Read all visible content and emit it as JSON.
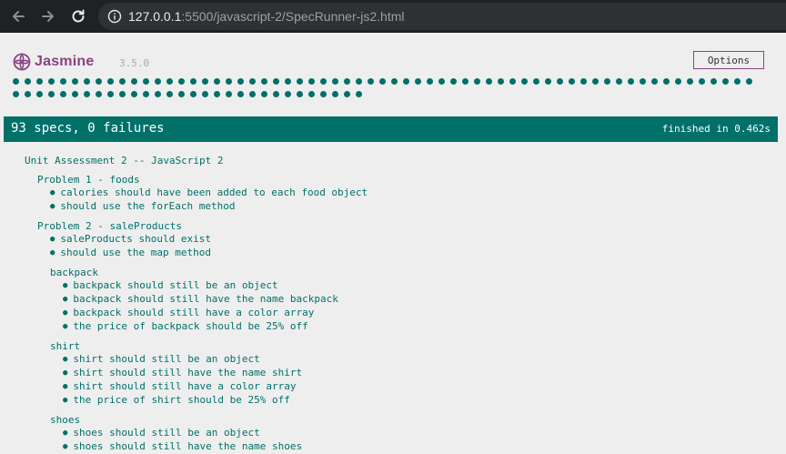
{
  "browser": {
    "url_host": "127.0.0.1",
    "url_rest": ":5500/javascript-2/SpecRunner-js2.html"
  },
  "header": {
    "logo": "Jasmine",
    "version": "3.5.0",
    "options_label": "Options"
  },
  "dots_count": 93,
  "summary": {
    "count_text": "93 specs, 0 failures",
    "finished_text": "finished in 0.462s"
  },
  "suite": {
    "title": "Unit Assessment 2 -- JavaScript 2",
    "children": [
      {
        "title": "Problem 1 - foods",
        "specs": [
          "calories should have been added to each food object",
          "should use the forEach method"
        ],
        "children": []
      },
      {
        "title": "Problem 2 - saleProducts",
        "specs": [
          "saleProducts should exist",
          "should use the map method"
        ],
        "children": [
          {
            "title": "backpack",
            "specs": [
              "backpack should still be an object",
              "backpack should still have the name backpack",
              "backpack should still have a color array",
              "the price of backpack should be 25% off"
            ]
          },
          {
            "title": "shirt",
            "specs": [
              "shirt should still be an object",
              "shirt should still have the name shirt",
              "shirt should still have a color array",
              "the price of shirt should be 25% off"
            ]
          },
          {
            "title": "shoes",
            "specs": [
              "shoes should still be an object",
              "shoes should still have the name shoes"
            ]
          }
        ]
      }
    ]
  },
  "colors": {
    "pass": "#007069",
    "brand": "#8a4182"
  }
}
